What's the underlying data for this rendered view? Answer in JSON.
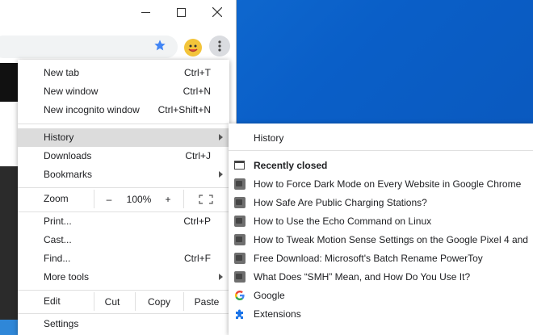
{
  "menu": {
    "new_tab": {
      "label": "New tab",
      "shortcut": "Ctrl+T"
    },
    "new_window": {
      "label": "New window",
      "shortcut": "Ctrl+N"
    },
    "new_incognito": {
      "label": "New incognito window",
      "shortcut": "Ctrl+Shift+N"
    },
    "history": {
      "label": "History"
    },
    "downloads": {
      "label": "Downloads",
      "shortcut": "Ctrl+J"
    },
    "bookmarks": {
      "label": "Bookmarks"
    },
    "zoom": {
      "label": "Zoom",
      "minus": "–",
      "level": "100%",
      "plus": "+"
    },
    "print": {
      "label": "Print...",
      "shortcut": "Ctrl+P"
    },
    "cast": {
      "label": "Cast..."
    },
    "find": {
      "label": "Find...",
      "shortcut": "Ctrl+F"
    },
    "more_tools": {
      "label": "More tools"
    },
    "edit": {
      "label": "Edit",
      "cut": "Cut",
      "copy": "Copy",
      "paste": "Paste"
    },
    "settings": {
      "label": "Settings"
    }
  },
  "history_submenu": {
    "history_label": "History",
    "recently_closed_label": "Recently closed",
    "items": [
      {
        "title": "How to Force Dark Mode on Every Website in Google Chrome",
        "icon": "htg-favicon"
      },
      {
        "title": "How Safe Are Public Charging Stations?",
        "icon": "htg-favicon"
      },
      {
        "title": "How to Use the Echo Command on Linux",
        "icon": "htg-favicon"
      },
      {
        "title": "How to Tweak Motion Sense Settings on the Google Pixel 4 and",
        "icon": "htg-favicon"
      },
      {
        "title": "Free Download: Microsoft's Batch Rename PowerToy",
        "icon": "htg-favicon"
      },
      {
        "title": "What Does “SMH” Mean, and How Do You Use It?",
        "icon": "htg-favicon"
      },
      {
        "title": "Google",
        "icon": "google-icon"
      },
      {
        "title": "Extensions",
        "icon": "puzzle-icon"
      }
    ]
  },
  "colors": {
    "accent_star": "#4285f4",
    "highlight": "#dcdcdc",
    "desktop": "#0a5fc8"
  }
}
